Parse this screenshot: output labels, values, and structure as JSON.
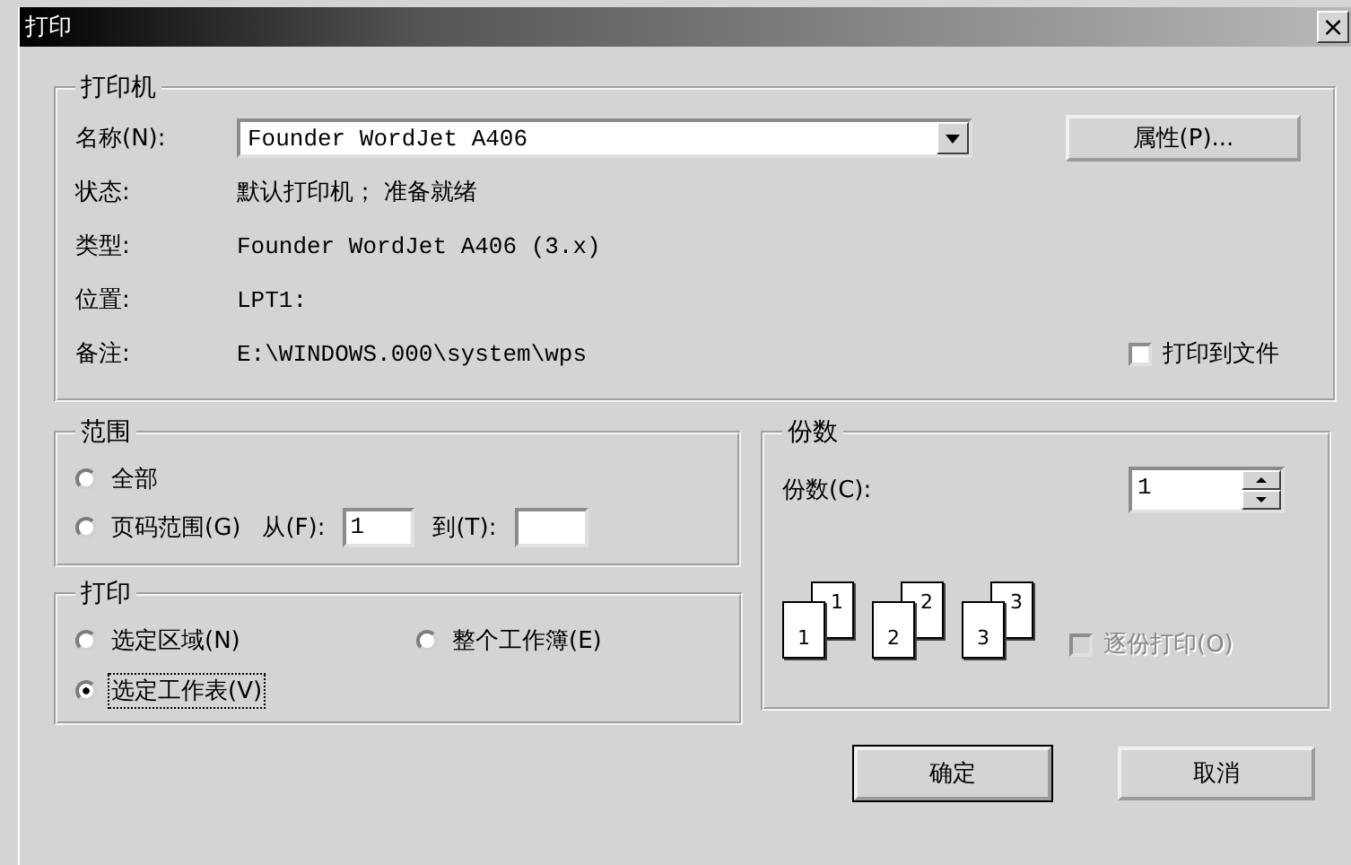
{
  "window": {
    "title": "打印",
    "close": "×"
  },
  "printer": {
    "legend": "打印机",
    "name_label": "名称(N):",
    "name_value": "Founder WordJet A406",
    "properties_button": "属性(P)...",
    "info": [
      {
        "label": "状态:",
        "value": "默认打印机； 准备就绪",
        "kind": "text"
      },
      {
        "label": "类型:",
        "value": "Founder WordJet A406 (3.x)",
        "kind": "mono"
      },
      {
        "label": "位置:",
        "value": "LPT1:",
        "kind": "mono"
      },
      {
        "label": "备注:",
        "value": "E:\\WINDOWS.000\\system\\wps",
        "kind": "mono"
      }
    ],
    "print_to_file": {
      "label": "打印到文件",
      "checked": false
    }
  },
  "range": {
    "legend": "范围",
    "options": [
      {
        "label": "全部",
        "selected": false
      },
      {
        "label": "页码范围(G)",
        "selected": false
      }
    ],
    "from_label": "从(F):",
    "from_value": "1",
    "to_label": "到(T):"
  },
  "print": {
    "legend": "打印",
    "options": [
      {
        "label": "选定区域(N)",
        "selected": false
      },
      {
        "label": "整个工作簿(E)",
        "selected": false
      },
      {
        "label": "选定工作表(V)",
        "selected": true
      }
    ]
  },
  "copies": {
    "legend": "份数",
    "label": "份数(C):",
    "value": "1",
    "stacks": [
      {
        "front": "1",
        "back": "1"
      },
      {
        "front": "2",
        "back": "2"
      },
      {
        "front": "3",
        "back": "3"
      }
    ],
    "collate": {
      "label": "逐份打印(O)",
      "checked": false,
      "disabled": true
    }
  },
  "buttons": [
    {
      "label": "确定",
      "default": true
    },
    {
      "label": "取消",
      "default": false
    }
  ]
}
